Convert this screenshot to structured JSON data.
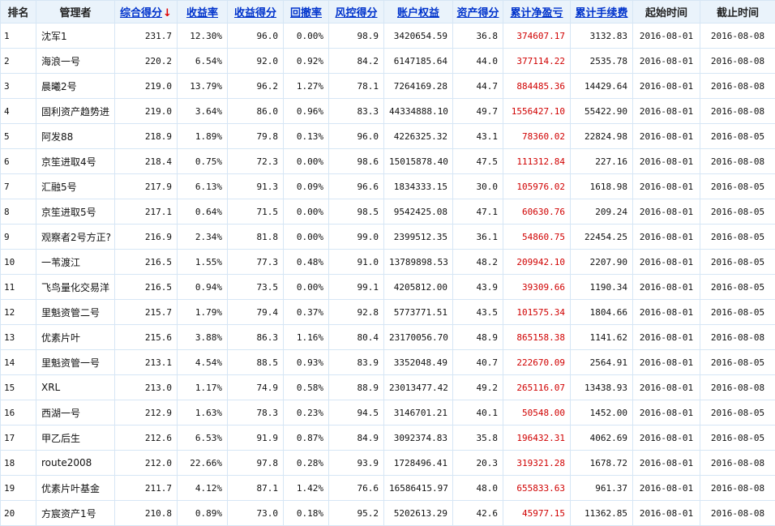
{
  "headers": {
    "rank": "排名",
    "manager": "管理者",
    "composite": "综合得分",
    "composite_arrow": "↓",
    "return_rate": "收益率",
    "return_score": "收益得分",
    "drawdown": "回撤率",
    "risk_score": "风控得分",
    "equity": "账户权益",
    "asset_score": "资产得分",
    "net_profit": "累计净盈亏",
    "fees": "累计手续费",
    "start": "起始时间",
    "end": "截止时间"
  },
  "colors": {
    "header_bg": "#eaf3fb",
    "link": "#0033cc",
    "profit": "#d00000",
    "border": "#d6e6f5"
  },
  "rows": [
    {
      "rank": "1",
      "manager": "沈军1",
      "composite": "231.7",
      "return_rate": "12.30%",
      "return_score": "96.0",
      "drawdown": "0.00%",
      "risk_score": "98.9",
      "equity": "3420654.59",
      "asset_score": "36.8",
      "net_profit": "374607.17",
      "fees": "3132.83",
      "start": "2016-08-01",
      "end": "2016-08-08"
    },
    {
      "rank": "2",
      "manager": "海浪一号",
      "composite": "220.2",
      "return_rate": "6.54%",
      "return_score": "92.0",
      "drawdown": "0.92%",
      "risk_score": "84.2",
      "equity": "6147185.64",
      "asset_score": "44.0",
      "net_profit": "377114.22",
      "fees": "2535.78",
      "start": "2016-08-01",
      "end": "2016-08-08"
    },
    {
      "rank": "3",
      "manager": "晨曦2号",
      "composite": "219.0",
      "return_rate": "13.79%",
      "return_score": "96.2",
      "drawdown": "1.27%",
      "risk_score": "78.1",
      "equity": "7264169.28",
      "asset_score": "44.7",
      "net_profit": "884485.36",
      "fees": "14429.64",
      "start": "2016-08-01",
      "end": "2016-08-08"
    },
    {
      "rank": "4",
      "manager": "固利资产趋势进",
      "composite": "219.0",
      "return_rate": "3.64%",
      "return_score": "86.0",
      "drawdown": "0.96%",
      "risk_score": "83.3",
      "equity": "44334888.10",
      "asset_score": "49.7",
      "net_profit": "1556427.10",
      "fees": "55422.90",
      "start": "2016-08-01",
      "end": "2016-08-08"
    },
    {
      "rank": "5",
      "manager": "阿发88",
      "composite": "218.9",
      "return_rate": "1.89%",
      "return_score": "79.8",
      "drawdown": "0.13%",
      "risk_score": "96.0",
      "equity": "4226325.32",
      "asset_score": "43.1",
      "net_profit": "78360.02",
      "fees": "22824.98",
      "start": "2016-08-01",
      "end": "2016-08-05"
    },
    {
      "rank": "6",
      "manager": "京笙进取4号",
      "composite": "218.4",
      "return_rate": "0.75%",
      "return_score": "72.3",
      "drawdown": "0.00%",
      "risk_score": "98.6",
      "equity": "15015878.40",
      "asset_score": "47.5",
      "net_profit": "111312.84",
      "fees": "227.16",
      "start": "2016-08-01",
      "end": "2016-08-08"
    },
    {
      "rank": "7",
      "manager": "汇融5号",
      "composite": "217.9",
      "return_rate": "6.13%",
      "return_score": "91.3",
      "drawdown": "0.09%",
      "risk_score": "96.6",
      "equity": "1834333.15",
      "asset_score": "30.0",
      "net_profit": "105976.02",
      "fees": "1618.98",
      "start": "2016-08-01",
      "end": "2016-08-05"
    },
    {
      "rank": "8",
      "manager": "京笙进取5号",
      "composite": "217.1",
      "return_rate": "0.64%",
      "return_score": "71.5",
      "drawdown": "0.00%",
      "risk_score": "98.5",
      "equity": "9542425.08",
      "asset_score": "47.1",
      "net_profit": "60630.76",
      "fees": "209.24",
      "start": "2016-08-01",
      "end": "2016-08-05"
    },
    {
      "rank": "9",
      "manager": "观察者2号方正?",
      "composite": "216.9",
      "return_rate": "2.34%",
      "return_score": "81.8",
      "drawdown": "0.00%",
      "risk_score": "99.0",
      "equity": "2399512.35",
      "asset_score": "36.1",
      "net_profit": "54860.75",
      "fees": "22454.25",
      "start": "2016-08-01",
      "end": "2016-08-05"
    },
    {
      "rank": "10",
      "manager": "一苇渡江",
      "composite": "216.5",
      "return_rate": "1.55%",
      "return_score": "77.3",
      "drawdown": "0.48%",
      "risk_score": "91.0",
      "equity": "13789898.53",
      "asset_score": "48.2",
      "net_profit": "209942.10",
      "fees": "2207.90",
      "start": "2016-08-01",
      "end": "2016-08-05"
    },
    {
      "rank": "11",
      "manager": "飞鸟量化交易洋",
      "composite": "216.5",
      "return_rate": "0.94%",
      "return_score": "73.5",
      "drawdown": "0.00%",
      "risk_score": "99.1",
      "equity": "4205812.00",
      "asset_score": "43.9",
      "net_profit": "39309.66",
      "fees": "1190.34",
      "start": "2016-08-01",
      "end": "2016-08-05"
    },
    {
      "rank": "12",
      "manager": "里魁资管二号",
      "composite": "215.7",
      "return_rate": "1.79%",
      "return_score": "79.4",
      "drawdown": "0.37%",
      "risk_score": "92.8",
      "equity": "5773771.51",
      "asset_score": "43.5",
      "net_profit": "101575.34",
      "fees": "1804.66",
      "start": "2016-08-01",
      "end": "2016-08-05"
    },
    {
      "rank": "13",
      "manager": "优素片叶",
      "composite": "215.6",
      "return_rate": "3.88%",
      "return_score": "86.3",
      "drawdown": "1.16%",
      "risk_score": "80.4",
      "equity": "23170056.70",
      "asset_score": "48.9",
      "net_profit": "865158.38",
      "fees": "1141.62",
      "start": "2016-08-01",
      "end": "2016-08-08"
    },
    {
      "rank": "14",
      "manager": "里魁资管一号",
      "composite": "213.1",
      "return_rate": "4.54%",
      "return_score": "88.5",
      "drawdown": "0.93%",
      "risk_score": "83.9",
      "equity": "3352048.49",
      "asset_score": "40.7",
      "net_profit": "222670.09",
      "fees": "2564.91",
      "start": "2016-08-01",
      "end": "2016-08-05"
    },
    {
      "rank": "15",
      "manager": "XRL",
      "composite": "213.0",
      "return_rate": "1.17%",
      "return_score": "74.9",
      "drawdown": "0.58%",
      "risk_score": "88.9",
      "equity": "23013477.42",
      "asset_score": "49.2",
      "net_profit": "265116.07",
      "fees": "13438.93",
      "start": "2016-08-01",
      "end": "2016-08-08"
    },
    {
      "rank": "16",
      "manager": "西湖一号",
      "composite": "212.9",
      "return_rate": "1.63%",
      "return_score": "78.3",
      "drawdown": "0.23%",
      "risk_score": "94.5",
      "equity": "3146701.21",
      "asset_score": "40.1",
      "net_profit": "50548.00",
      "fees": "1452.00",
      "start": "2016-08-01",
      "end": "2016-08-05"
    },
    {
      "rank": "17",
      "manager": "甲乙后生",
      "composite": "212.6",
      "return_rate": "6.53%",
      "return_score": "91.9",
      "drawdown": "0.87%",
      "risk_score": "84.9",
      "equity": "3092374.83",
      "asset_score": "35.8",
      "net_profit": "196432.31",
      "fees": "4062.69",
      "start": "2016-08-01",
      "end": "2016-08-05"
    },
    {
      "rank": "18",
      "manager": "route2008",
      "composite": "212.0",
      "return_rate": "22.66%",
      "return_score": "97.8",
      "drawdown": "0.28%",
      "risk_score": "93.9",
      "equity": "1728496.41",
      "asset_score": "20.3",
      "net_profit": "319321.28",
      "fees": "1678.72",
      "start": "2016-08-01",
      "end": "2016-08-08"
    },
    {
      "rank": "19",
      "manager": "优素片叶基金",
      "composite": "211.7",
      "return_rate": "4.12%",
      "return_score": "87.1",
      "drawdown": "1.42%",
      "risk_score": "76.6",
      "equity": "16586415.97",
      "asset_score": "48.0",
      "net_profit": "655833.63",
      "fees": "961.37",
      "start": "2016-08-01",
      "end": "2016-08-08"
    },
    {
      "rank": "20",
      "manager": "方宸资产1号",
      "composite": "210.8",
      "return_rate": "0.89%",
      "return_score": "73.0",
      "drawdown": "0.18%",
      "risk_score": "95.2",
      "equity": "5202613.29",
      "asset_score": "42.6",
      "net_profit": "45977.15",
      "fees": "11362.85",
      "start": "2016-08-01",
      "end": "2016-08-08"
    }
  ]
}
